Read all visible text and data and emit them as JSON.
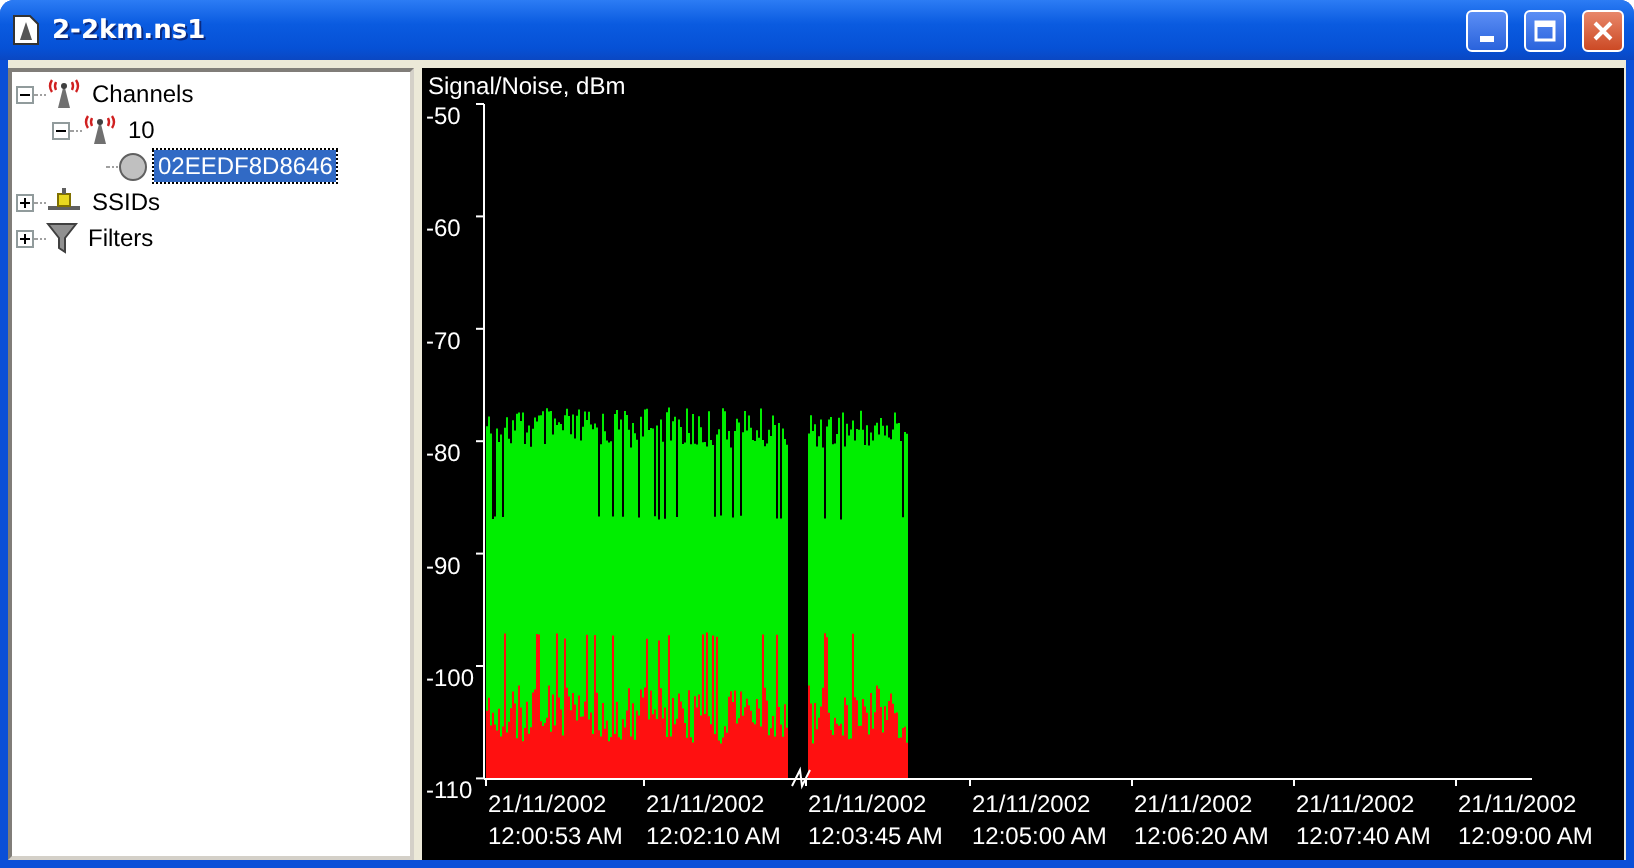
{
  "window": {
    "title": "2-2km.ns1"
  },
  "tree": [
    {
      "label": "Channels",
      "kind": "channel",
      "expanded": true,
      "selected": false,
      "children": [
        {
          "label": "10",
          "kind": "channel",
          "expanded": true,
          "selected": false,
          "children": [
            {
              "label": "02EEDF8D8646",
              "kind": "station",
              "selected": true
            }
          ]
        }
      ]
    },
    {
      "label": "SSIDs",
      "kind": "ssid",
      "expanded": false,
      "selected": false
    },
    {
      "label": "Filters",
      "kind": "filter",
      "expanded": false,
      "selected": false
    }
  ],
  "chart": {
    "ylabel": "Signal/Noise, dBm",
    "yticks": [
      "-50",
      "-60",
      "-70",
      "-80",
      "-90",
      "-100",
      "-110"
    ],
    "xticks": [
      {
        "date": "21/11/2002",
        "time": "12:00:53 AM"
      },
      {
        "date": "21/11/2002",
        "time": "12:02:10 AM"
      },
      {
        "date": "21/11/2002",
        "time": "12:03:45 AM"
      },
      {
        "date": "21/11/2002",
        "time": "12:05:00 AM"
      },
      {
        "date": "21/11/2002",
        "time": "12:06:20 AM"
      },
      {
        "date": "21/11/2002",
        "time": "12:07:40 AM"
      },
      {
        "date": "21/11/2002",
        "time": "12:09:00 AM"
      }
    ]
  }
}
